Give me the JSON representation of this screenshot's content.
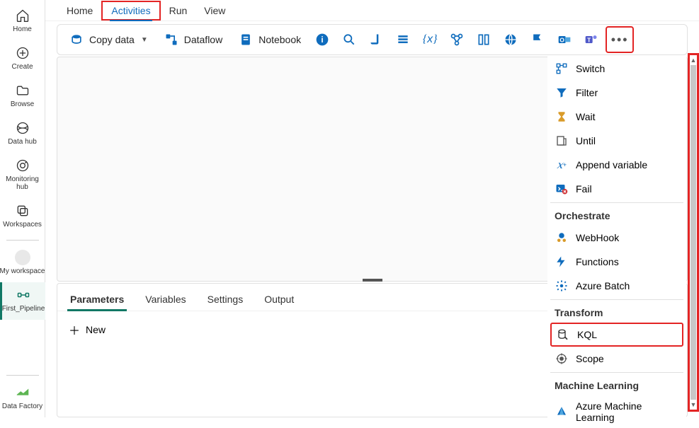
{
  "left_nav": {
    "items": [
      {
        "name": "home",
        "label": "Home"
      },
      {
        "name": "create",
        "label": "Create"
      },
      {
        "name": "browse",
        "label": "Browse"
      },
      {
        "name": "datahub",
        "label": "Data hub"
      },
      {
        "name": "monitoring",
        "label": "Monitoring hub"
      },
      {
        "name": "workspaces",
        "label": "Workspaces"
      }
    ],
    "recent": [
      {
        "name": "myworkspace",
        "label": "My workspace"
      },
      {
        "name": "pipeline",
        "label": "First_Pipeline",
        "active": true
      }
    ],
    "footer": {
      "name": "datafactory",
      "label": "Data Factory"
    }
  },
  "top_tabs": [
    "Home",
    "Activities",
    "Run",
    "View"
  ],
  "top_tabs_selected": "Activities",
  "toolbar": {
    "copy_data": "Copy data",
    "dataflow": "Dataflow",
    "notebook": "Notebook"
  },
  "bottom_tabs": [
    "Parameters",
    "Variables",
    "Settings",
    "Output"
  ],
  "bottom_tabs_selected": "Parameters",
  "new_button": "New",
  "dropdown": {
    "items1": [
      "Switch",
      "Filter",
      "Wait",
      "Until",
      "Append variable",
      "Fail"
    ],
    "group_orchestrate": "Orchestrate",
    "items2": [
      "WebHook",
      "Functions",
      "Azure Batch"
    ],
    "group_transform": "Transform",
    "items3": [
      "KQL",
      "Scope"
    ],
    "group_ml": "Machine Learning",
    "items4": [
      "Azure Machine Learning"
    ]
  }
}
